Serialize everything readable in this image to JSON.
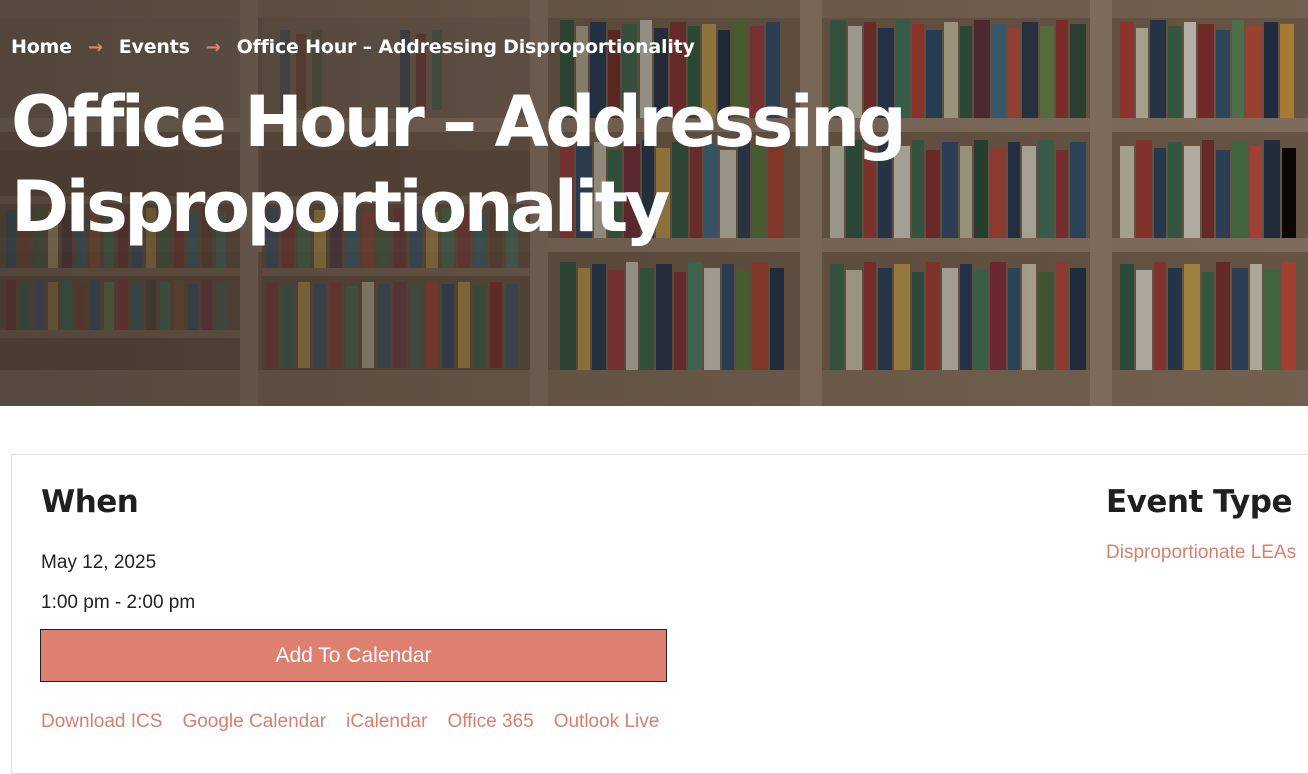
{
  "breadcrumb": {
    "home": "Home",
    "events": "Events",
    "current": "Office Hour – Addressing Disproportionality",
    "separator": "→"
  },
  "hero": {
    "title_line1": "Office Hour – Addressing",
    "title_line2": "Disproportionality"
  },
  "when": {
    "heading": "When",
    "date": "May 12, 2025",
    "time": "1:00 pm - 2:00 pm",
    "add_to_calendar": "Add To Calendar",
    "calendar_links": [
      "Download ICS",
      "Google Calendar",
      "iCalendar",
      "Office 365",
      "Outlook Live"
    ]
  },
  "event_type": {
    "heading": "Event Type",
    "value": "Disproportionate LEAs"
  },
  "colors": {
    "accent": "#de8070",
    "link": "#d97f6c",
    "heading": "#1f1f1f"
  }
}
